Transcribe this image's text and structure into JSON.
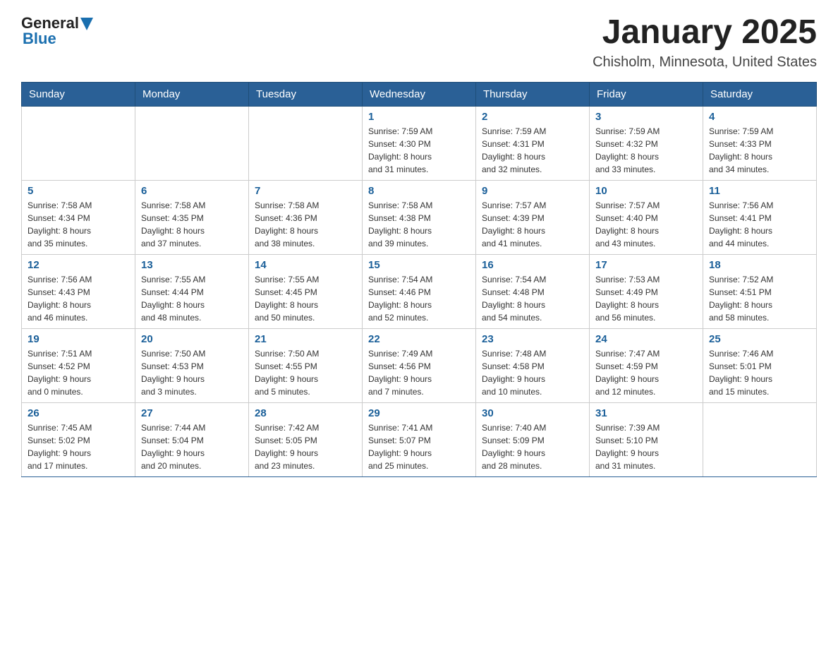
{
  "header": {
    "logo": {
      "general": "General",
      "blue": "Blue"
    },
    "title": "January 2025",
    "location": "Chisholm, Minnesota, United States"
  },
  "days_of_week": [
    "Sunday",
    "Monday",
    "Tuesday",
    "Wednesday",
    "Thursday",
    "Friday",
    "Saturday"
  ],
  "weeks": [
    [
      {
        "day": "",
        "info": ""
      },
      {
        "day": "",
        "info": ""
      },
      {
        "day": "",
        "info": ""
      },
      {
        "day": "1",
        "info": "Sunrise: 7:59 AM\nSunset: 4:30 PM\nDaylight: 8 hours\nand 31 minutes."
      },
      {
        "day": "2",
        "info": "Sunrise: 7:59 AM\nSunset: 4:31 PM\nDaylight: 8 hours\nand 32 minutes."
      },
      {
        "day": "3",
        "info": "Sunrise: 7:59 AM\nSunset: 4:32 PM\nDaylight: 8 hours\nand 33 minutes."
      },
      {
        "day": "4",
        "info": "Sunrise: 7:59 AM\nSunset: 4:33 PM\nDaylight: 8 hours\nand 34 minutes."
      }
    ],
    [
      {
        "day": "5",
        "info": "Sunrise: 7:58 AM\nSunset: 4:34 PM\nDaylight: 8 hours\nand 35 minutes."
      },
      {
        "day": "6",
        "info": "Sunrise: 7:58 AM\nSunset: 4:35 PM\nDaylight: 8 hours\nand 37 minutes."
      },
      {
        "day": "7",
        "info": "Sunrise: 7:58 AM\nSunset: 4:36 PM\nDaylight: 8 hours\nand 38 minutes."
      },
      {
        "day": "8",
        "info": "Sunrise: 7:58 AM\nSunset: 4:38 PM\nDaylight: 8 hours\nand 39 minutes."
      },
      {
        "day": "9",
        "info": "Sunrise: 7:57 AM\nSunset: 4:39 PM\nDaylight: 8 hours\nand 41 minutes."
      },
      {
        "day": "10",
        "info": "Sunrise: 7:57 AM\nSunset: 4:40 PM\nDaylight: 8 hours\nand 43 minutes."
      },
      {
        "day": "11",
        "info": "Sunrise: 7:56 AM\nSunset: 4:41 PM\nDaylight: 8 hours\nand 44 minutes."
      }
    ],
    [
      {
        "day": "12",
        "info": "Sunrise: 7:56 AM\nSunset: 4:43 PM\nDaylight: 8 hours\nand 46 minutes."
      },
      {
        "day": "13",
        "info": "Sunrise: 7:55 AM\nSunset: 4:44 PM\nDaylight: 8 hours\nand 48 minutes."
      },
      {
        "day": "14",
        "info": "Sunrise: 7:55 AM\nSunset: 4:45 PM\nDaylight: 8 hours\nand 50 minutes."
      },
      {
        "day": "15",
        "info": "Sunrise: 7:54 AM\nSunset: 4:46 PM\nDaylight: 8 hours\nand 52 minutes."
      },
      {
        "day": "16",
        "info": "Sunrise: 7:54 AM\nSunset: 4:48 PM\nDaylight: 8 hours\nand 54 minutes."
      },
      {
        "day": "17",
        "info": "Sunrise: 7:53 AM\nSunset: 4:49 PM\nDaylight: 8 hours\nand 56 minutes."
      },
      {
        "day": "18",
        "info": "Sunrise: 7:52 AM\nSunset: 4:51 PM\nDaylight: 8 hours\nand 58 minutes."
      }
    ],
    [
      {
        "day": "19",
        "info": "Sunrise: 7:51 AM\nSunset: 4:52 PM\nDaylight: 9 hours\nand 0 minutes."
      },
      {
        "day": "20",
        "info": "Sunrise: 7:50 AM\nSunset: 4:53 PM\nDaylight: 9 hours\nand 3 minutes."
      },
      {
        "day": "21",
        "info": "Sunrise: 7:50 AM\nSunset: 4:55 PM\nDaylight: 9 hours\nand 5 minutes."
      },
      {
        "day": "22",
        "info": "Sunrise: 7:49 AM\nSunset: 4:56 PM\nDaylight: 9 hours\nand 7 minutes."
      },
      {
        "day": "23",
        "info": "Sunrise: 7:48 AM\nSunset: 4:58 PM\nDaylight: 9 hours\nand 10 minutes."
      },
      {
        "day": "24",
        "info": "Sunrise: 7:47 AM\nSunset: 4:59 PM\nDaylight: 9 hours\nand 12 minutes."
      },
      {
        "day": "25",
        "info": "Sunrise: 7:46 AM\nSunset: 5:01 PM\nDaylight: 9 hours\nand 15 minutes."
      }
    ],
    [
      {
        "day": "26",
        "info": "Sunrise: 7:45 AM\nSunset: 5:02 PM\nDaylight: 9 hours\nand 17 minutes."
      },
      {
        "day": "27",
        "info": "Sunrise: 7:44 AM\nSunset: 5:04 PM\nDaylight: 9 hours\nand 20 minutes."
      },
      {
        "day": "28",
        "info": "Sunrise: 7:42 AM\nSunset: 5:05 PM\nDaylight: 9 hours\nand 23 minutes."
      },
      {
        "day": "29",
        "info": "Sunrise: 7:41 AM\nSunset: 5:07 PM\nDaylight: 9 hours\nand 25 minutes."
      },
      {
        "day": "30",
        "info": "Sunrise: 7:40 AM\nSunset: 5:09 PM\nDaylight: 9 hours\nand 28 minutes."
      },
      {
        "day": "31",
        "info": "Sunrise: 7:39 AM\nSunset: 5:10 PM\nDaylight: 9 hours\nand 31 minutes."
      },
      {
        "day": "",
        "info": ""
      }
    ]
  ]
}
